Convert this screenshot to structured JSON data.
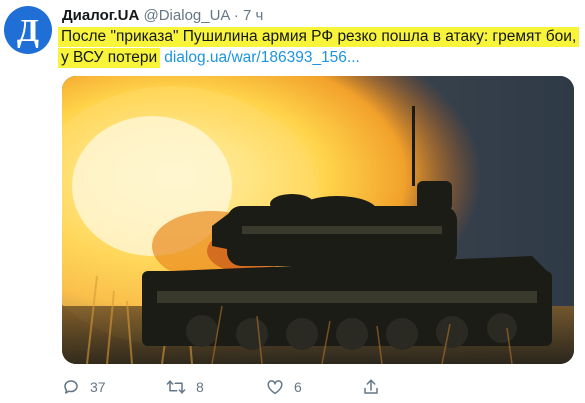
{
  "tweet": {
    "avatar_letter": "Д",
    "display_name": "Диалог.UA",
    "handle": "@Dialog_UA",
    "separator": "·",
    "time": "7 ч",
    "text": "После \"приказа\" Пушилина армия РФ резко пошла в атаку: гремят бои, у ВСУ потери",
    "link": "dialog.ua/war/186393_156...",
    "highlight_color": "#f8f43a",
    "link_color": "#1b95e0"
  },
  "actions": {
    "replies": "37",
    "retweets": "8",
    "likes": "6"
  },
  "icons": [
    "reply-icon",
    "retweet-icon",
    "like-icon",
    "share-icon"
  ]
}
